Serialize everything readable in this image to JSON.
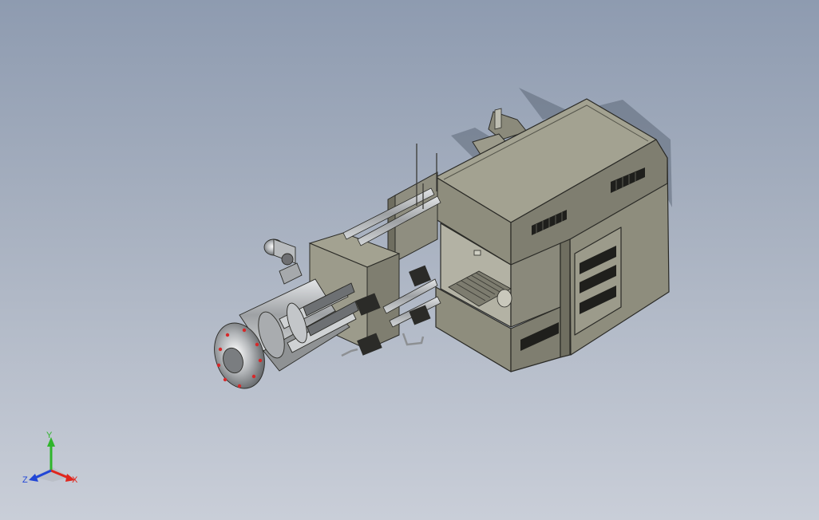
{
  "viewport": {
    "background_top": "#8e9bb0",
    "background_bottom": "#c9ced8"
  },
  "model": {
    "body_color": "#8e8d7d",
    "body_light": "#a3a291",
    "body_dark": "#6f6e60",
    "metal_color": "#b9bcbf"
  },
  "triad": {
    "x_label": "X",
    "y_label": "Y",
    "z_label": "Z",
    "x_color": "#e0261d",
    "y_color": "#2fb52b",
    "z_color": "#2146d6"
  }
}
